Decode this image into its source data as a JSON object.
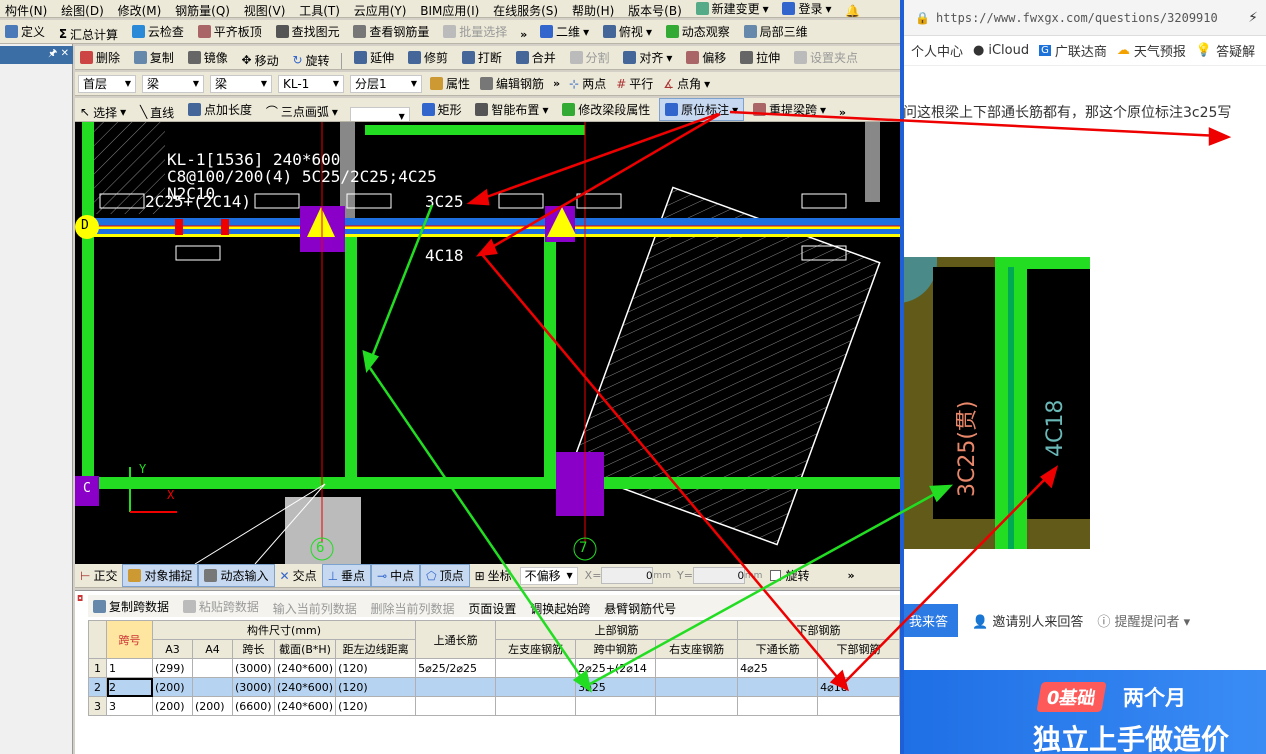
{
  "menu": [
    "构件(N)",
    "绘图(D)",
    "修改(M)",
    "钢筋量(Q)",
    "视图(V)",
    "工具(T)",
    "云应用(Y)",
    "BIM应用(I)",
    "在线服务(S)",
    "帮助(H)",
    "版本号(B)",
    "新建变更",
    "登录"
  ],
  "toolbar1": [
    "定义",
    "汇总计算",
    "云检查",
    "平齐板顶",
    "查找图元",
    "查看钢筋量",
    "批量选择",
    "二维",
    "俯视",
    "动态观察",
    "局部三维"
  ],
  "toolbar2": [
    "删除",
    "复制",
    "镜像",
    "移动",
    "旋转",
    "延伸",
    "修剪",
    "打断",
    "合并",
    "分割",
    "对齐",
    "偏移",
    "拉伸",
    "设置夹点"
  ],
  "selectors": {
    "floor": "首层",
    "type1": "梁",
    "type2": "梁",
    "element": "KL-1",
    "layer": "分层1",
    "attr": "属性",
    "edit_rebar": "编辑钢筋",
    "two_point": "两点",
    "parallel": "平行",
    "point_angle": "点角"
  },
  "toolbar4": [
    "选择",
    "直线",
    "点加长度",
    "三点画弧",
    "矩形",
    "智能布置",
    "修改梁段属性",
    "原位标注",
    "重提梁跨"
  ],
  "cad": {
    "label1": "KL-1[1536] 240*600",
    "label2": "C8@100/200(4) 5C25/2C25;4C25",
    "label3": "N2C10",
    "label4": "2C25+(2C14)",
    "top_mid": "3C25",
    "bot_mid": "4C18",
    "axis_d": "D",
    "axis_c": "C",
    "axis_6": "6",
    "axis_7": "7",
    "y_axis": "Y",
    "x_axis": "X"
  },
  "statusbar": {
    "ortho": "正交",
    "snap": "对象捕捉",
    "dyn": "动态输入",
    "cross": "交点",
    "perp": "垂点",
    "mid": "中点",
    "vertex": "顶点",
    "coord": "坐标",
    "offset": "不偏移",
    "x_label": "X=",
    "x_val": "0",
    "y_label": "Y=",
    "y_val": "0",
    "mm": "mm",
    "rotate": "旋转"
  },
  "grid_toolbar": [
    "复制跨数据",
    "粘贴跨数据",
    "输入当前列数据",
    "删除当前列数据",
    "页面设置",
    "调换起始跨",
    "悬臂钢筋代号"
  ],
  "grid": {
    "h_span": "跨号",
    "h_size": "构件尺寸(mm)",
    "h_top_through": "上通长筋",
    "h_top": "上部钢筋",
    "h_bot": "下部钢筋",
    "h_a3": "A3",
    "h_a4": "A4",
    "h_len": "跨长",
    "h_sec": "截面(B*H)",
    "h_dist": "距左边线距离",
    "h_left": "左支座钢筋",
    "h_mid": "跨中钢筋",
    "h_right": "右支座钢筋",
    "h_bot_through": "下通长筋",
    "h_bot_bar": "下部钢筋",
    "rows": [
      {
        "n": "1",
        "span": "1",
        "a3": "(299)",
        "a4": "",
        "len": "(3000)",
        "sec": "(240*600)",
        "dist": "(120)",
        "top_through": "5⌀25/2⌀25",
        "left": "",
        "mid": "2⌀25+(2⌀14",
        "right": "",
        "bot_through": "4⌀25",
        "bot": ""
      },
      {
        "n": "2",
        "span": "2",
        "a3": "(200)",
        "a4": "",
        "len": "(3000)",
        "sec": "(240*600)",
        "dist": "(120)",
        "top_through": "",
        "left": "",
        "mid": "3⌀25",
        "right": "",
        "bot_through": "",
        "bot": "4⌀18"
      },
      {
        "n": "3",
        "span": "3",
        "a3": "(200)",
        "a4": "(200)",
        "len": "(6600)",
        "sec": "(240*600)",
        "dist": "(120)",
        "top_through": "",
        "left": "",
        "mid": "",
        "right": "",
        "bot_through": "",
        "bot": ""
      }
    ]
  },
  "browser": {
    "url": "https://www.fwxgx.com/questions/3209910",
    "bookmarks": [
      "个人中心",
      "iCloud",
      "广联达商",
      "天气预报",
      "答疑解"
    ],
    "question": "问这根梁上下部通长筋都有，那这个原位标注3c25写",
    "photo_left": "3C25(贯)",
    "photo_right": "4C18",
    "answer_btn": "我来答",
    "invite": "邀请别人来回答",
    "remind": "提醒提问者",
    "ad1": "0基础",
    "ad2": "两个月",
    "ad3": "独立上手做造价"
  },
  "colors": {
    "accent_red": "#e00000",
    "accent_green": "#22dd22",
    "beam_yellow": "#ffff00",
    "beam_blue": "#1e6fe0",
    "purple": "#8a00c8"
  }
}
